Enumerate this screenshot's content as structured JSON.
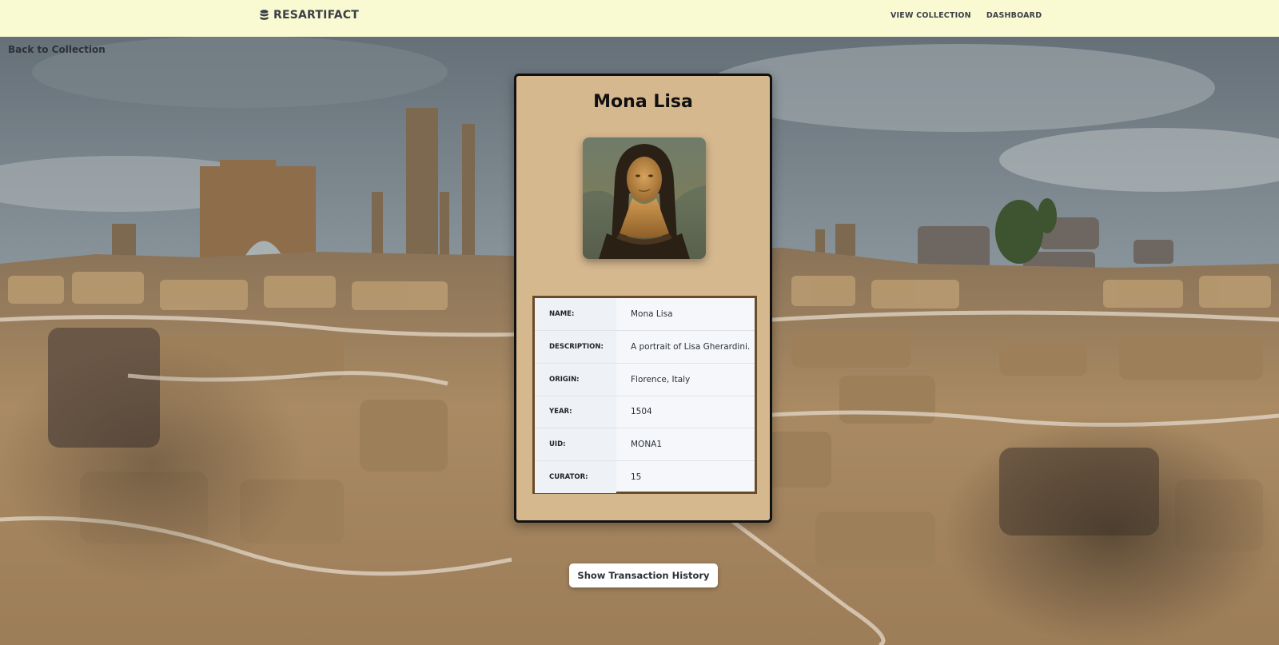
{
  "navbar": {
    "brand_icon": "database-icon",
    "brand": "RESARTIFACT",
    "links": [
      "VIEW COLLECTION",
      "DASHBOARD"
    ]
  },
  "back_link": "Back to Collection",
  "artifact": {
    "title": "Mona Lisa",
    "image_alt": "Mona Lisa",
    "fields": [
      {
        "label": "NAME:",
        "value": "Mona Lisa"
      },
      {
        "label": "DESCRIPTION:",
        "value": "A portrait of Lisa Gherardini."
      },
      {
        "label": "ORIGIN:",
        "value": "Florence, Italy"
      },
      {
        "label": "YEAR:",
        "value": "1504"
      },
      {
        "label": "UID:",
        "value": "MONA1"
      },
      {
        "label": "CURATOR:",
        "value": "15"
      }
    ]
  },
  "history_button": "Show Transaction History",
  "colors": {
    "navbar_bg": "#fafad2",
    "card_bg": "#d6b88f",
    "table_border": "#6b4a2a"
  }
}
